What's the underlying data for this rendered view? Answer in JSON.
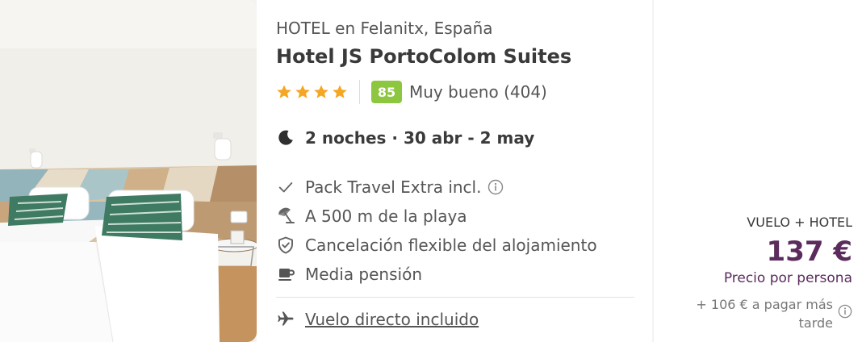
{
  "hotel": {
    "subtitle": "HOTEL en Felanitx, España",
    "name": "Hotel JS PortoColom Suites",
    "stars": 4,
    "score": "85",
    "score_text": "Muy bueno (404)",
    "image_icon": "hotel-room-photo"
  },
  "stay": {
    "icon": "moon-icon",
    "dates": "2 noches · 30 abr - 2 may"
  },
  "features": [
    {
      "icon": "check-icon",
      "label": "Pack Travel Extra incl.",
      "info": true
    },
    {
      "icon": "beach-umbrella-icon",
      "label": "A 500 m de la playa",
      "info": false
    },
    {
      "icon": "shield-check-icon",
      "label": "Cancelación flexible del alojamiento",
      "info": false
    },
    {
      "icon": "coffee-cup-icon",
      "label": "Media pensión",
      "info": false
    }
  ],
  "flight": {
    "icon": "airplane-icon",
    "label": "Vuelo directo incluido"
  },
  "price": {
    "label": "VUELO + HOTEL",
    "value": "137 €",
    "per_person": "Precio por persona",
    "later": "+ 106 € a pagar más tarde"
  },
  "colors": {
    "star": "#f5a623",
    "score_badge": "#8dc63f",
    "price": "#5a2b5c"
  }
}
